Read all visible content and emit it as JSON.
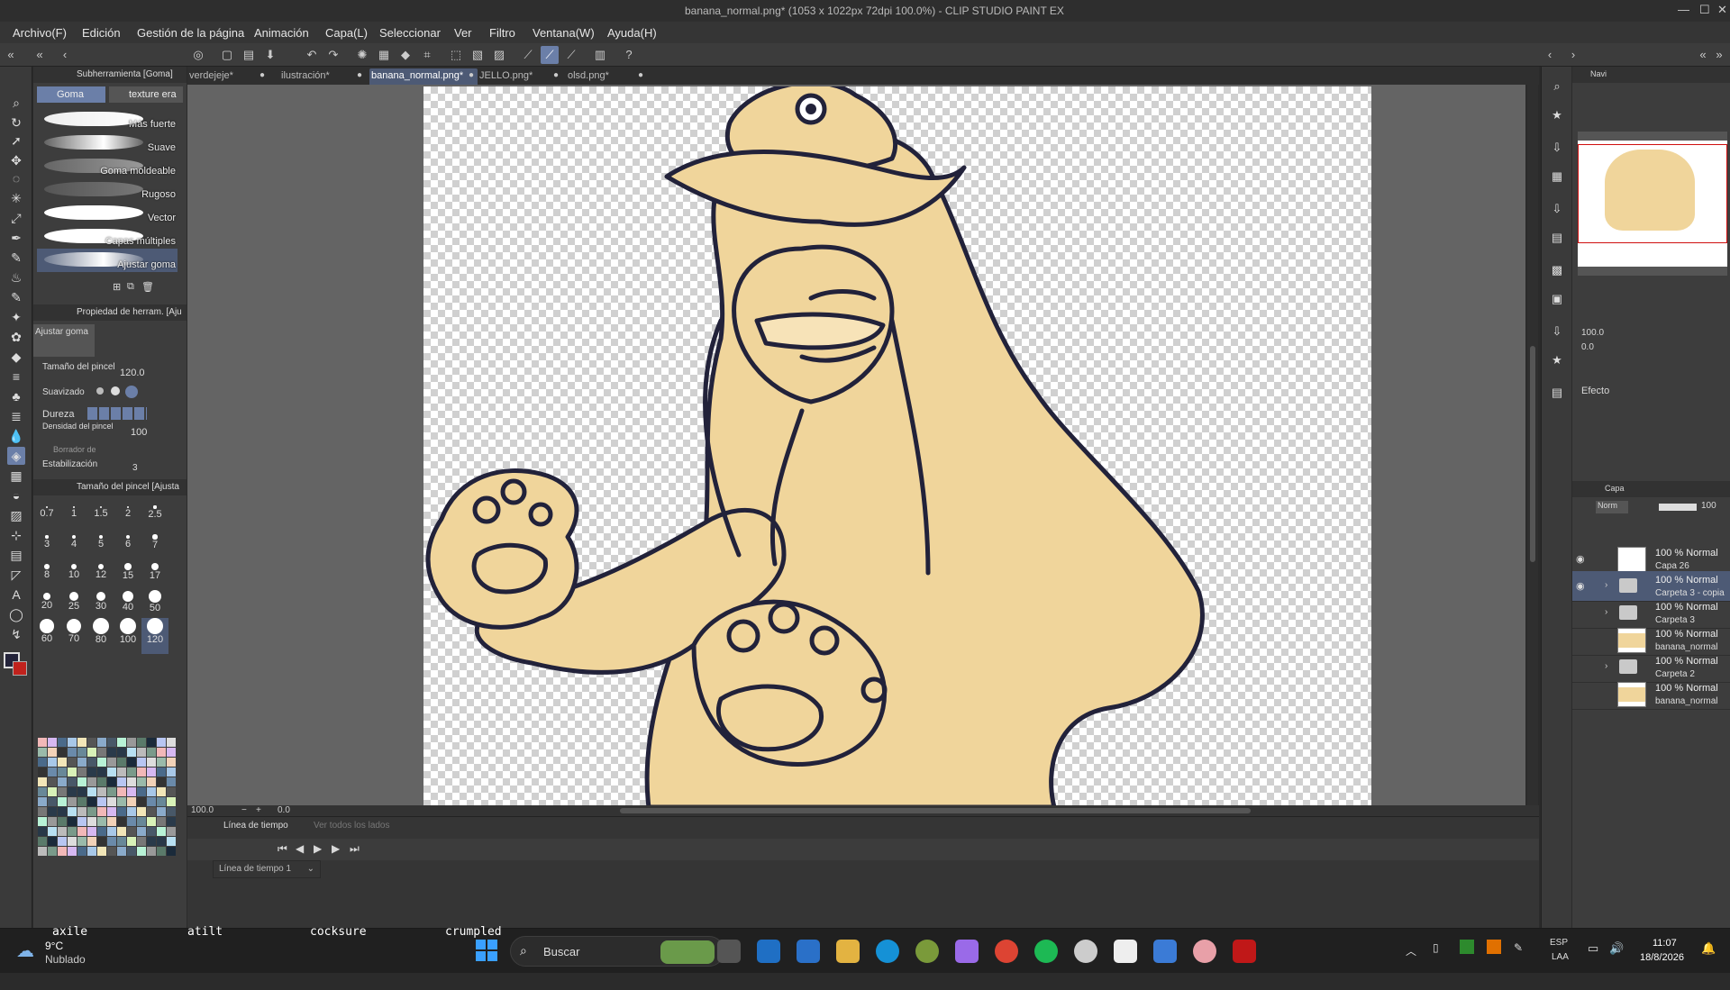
{
  "window": {
    "title": "banana_normal.png* (1053 x 1022px 72dpi 100.0%) - CLIP STUDIO PAINT EX"
  },
  "menu": [
    "Archivo(F)",
    "Edición",
    "Gestión de la página",
    "Animación",
    "Capa(L)",
    "Seleccionar",
    "Ver",
    "Filtro",
    "Ventana(W)",
    "Ayuda(H)"
  ],
  "doc_tabs": [
    {
      "label": "verdejeje*"
    },
    {
      "label": "ilustración*"
    },
    {
      "label": "banana_normal.png*",
      "active": true
    },
    {
      "label": "JELLO.png*"
    },
    {
      "label": "olsd.png*"
    }
  ],
  "subtool": {
    "header": "Subherramienta [Goma]",
    "tab1": "Goma",
    "tab2": "texture era",
    "brushes": [
      "Más fuerte",
      "Suave",
      "Goma moldeable",
      "Rugoso",
      "Vector",
      "Capas múltiples",
      "Ajustar goma"
    ],
    "selected_brush": "Ajustar goma"
  },
  "tool_property": {
    "header": "Propiedad de herram. [Aju",
    "preview_label": "Ajustar goma",
    "brush_size_label": "Tamaño del pincel",
    "brush_size_value": "120.0",
    "smoothing_label": "Suavizado",
    "hardness_label": "Dureza",
    "density_label": "Densidad del pincel",
    "density_value": "100",
    "eraser_label": "Borrador de",
    "stabilization_label": "Estabilización",
    "stabilization_value": "3"
  },
  "brush_size_panel": {
    "header": "Tamaño del pincel [Ajusta",
    "sizes": [
      "0.7",
      "1",
      "1.5",
      "2",
      "2.5",
      "3",
      "4",
      "5",
      "6",
      "7",
      "8",
      "10",
      "12",
      "15",
      "17",
      "20",
      "25",
      "30",
      "40",
      "50",
      "60",
      "70",
      "80",
      "100",
      "120"
    ]
  },
  "colors": {
    "main": "#23233a",
    "sub": "#c0221d",
    "skin": "#f0d59b",
    "line": "#22223a"
  },
  "canvas": {
    "zoom": "100.0",
    "rotation": "0.0"
  },
  "timeline": {
    "tab": "Línea de tiempo",
    "tab2": "Ver todos los lados",
    "dropdown": "Línea de tiempo 1"
  },
  "navigator": {
    "tab": "Navi",
    "zoom": "100.0",
    "rotation": "0.0"
  },
  "effect": {
    "label": "Efecto"
  },
  "layers": {
    "tab": "Capa",
    "blend": "Norm",
    "opacity": "100",
    "items": [
      {
        "mode": "100 % Normal",
        "name": "Capa 26",
        "type": "layer",
        "visible": true
      },
      {
        "mode": "100 % Normal",
        "name": "Carpeta 3 - copia",
        "type": "folder",
        "visible": true,
        "selected": true
      },
      {
        "mode": "100 % Normal",
        "name": "Carpeta 3",
        "type": "folder",
        "visible": false
      },
      {
        "mode": "100 % Normal",
        "name": "banana_normal",
        "type": "image",
        "visible": false
      },
      {
        "mode": "100 % Normal",
        "name": "Carpeta 2",
        "type": "folder",
        "visible": false
      },
      {
        "mode": "100 % Normal",
        "name": "banana_normal",
        "type": "image",
        "visible": false
      }
    ]
  },
  "taskbar": {
    "terminal_words": [
      "axile",
      "atilt",
      "cocksure",
      "crumpled"
    ],
    "weather_temp": "9°C",
    "weather_desc": "Nublado",
    "search_placeholder": "Buscar",
    "lang1": "ESP",
    "lang2": "LAA",
    "time": "11:07",
    "date": "18/8/2026"
  }
}
